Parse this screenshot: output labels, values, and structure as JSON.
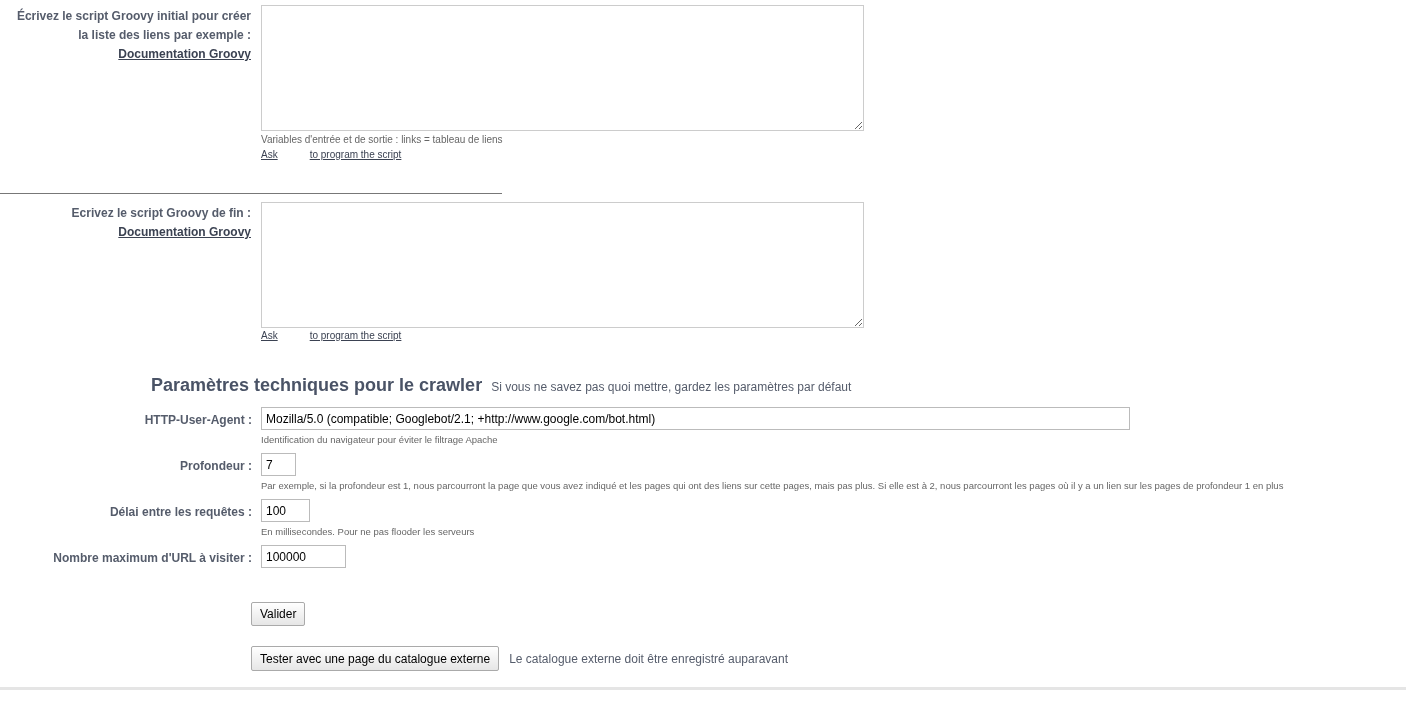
{
  "script_sections": [
    {
      "label": "Écrivez le script Groovy initial pour créer la liste des liens par exemple :",
      "doc_link": "Documentation Groovy",
      "hint": "Variables d'entrée et de sortie : links = tableau de liens",
      "ask_links": [
        "Ask",
        "to program the script"
      ]
    },
    {
      "label": "Ecrivez le script Groovy de fin :",
      "doc_link": "Documentation Groovy",
      "ask_links": [
        "Ask",
        "to program the script"
      ]
    }
  ],
  "technical": {
    "title": "Paramètres techniques pour le crawler",
    "subtitle": "Si vous ne savez pas quoi mettre, gardez les paramètres par défaut",
    "fields": [
      {
        "label": "HTTP-User-Agent :",
        "value": "Mozilla/5.0 (compatible; Googlebot/2.1; +http://www.google.com/bot.html)",
        "hint": "Identification du navigateur pour éviter le filtrage Apache"
      },
      {
        "label": "Profondeur :",
        "value": "7",
        "hint": "Par exemple, si la profondeur est 1, nous parcourront la page que vous avez indiqué et les pages qui ont des liens sur cette pages, mais pas plus. Si elle est à 2, nous parcourront les pages où il y a un lien sur les pages de profondeur 1 en plus"
      },
      {
        "label": "Délai entre les requêtes :",
        "value": "100",
        "hint": "En millisecondes. Pour ne pas flooder les serveurs"
      },
      {
        "label": "Nombre maximum d'URL à visiter :",
        "value": "100000"
      }
    ]
  },
  "validate_button": "Valider",
  "test_button": "Tester avec une page du catalogue externe",
  "test_note": "Le catalogue externe doit être enregistré auparavant"
}
